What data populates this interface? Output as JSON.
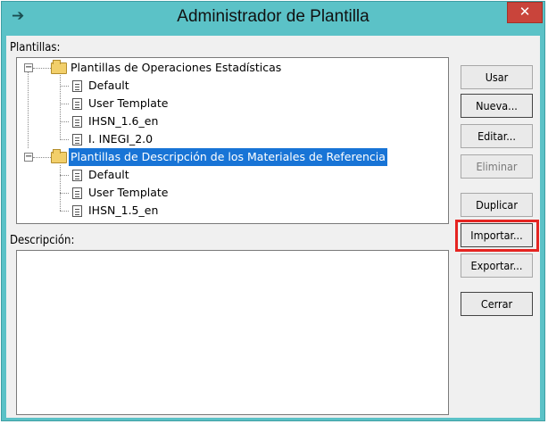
{
  "window": {
    "title": "Administrador de Plantilla",
    "app_icon": "arrow-right-icon",
    "close_glyph": "✕"
  },
  "templates_label": "Plantillas:",
  "tree": {
    "groups": [
      {
        "label": "Plantillas de Operaciones Estadísticas",
        "expanded": true,
        "selected": false,
        "items": [
          "Default",
          "User Template",
          "IHSN_1.6_en",
          "I. INEGI_2.0"
        ]
      },
      {
        "label": "Plantillas de Descripción de los Materiales de Referencia",
        "expanded": true,
        "selected": true,
        "items": [
          "Default",
          "User Template",
          "IHSN_1.5_en"
        ]
      }
    ]
  },
  "description_label": "Descripción:",
  "description_value": "",
  "buttons": {
    "use": "Usar",
    "new": "Nueva...",
    "edit": "Editar...",
    "delete": "Eliminar",
    "duplicate": "Duplicar",
    "import": "Importar...",
    "export": "Exportar...",
    "close": "Cerrar"
  },
  "colors": {
    "title_bar": "#5bc2c7",
    "selection": "#1874d6",
    "highlight_box": "#e52421",
    "close_button": "#c9443b"
  }
}
